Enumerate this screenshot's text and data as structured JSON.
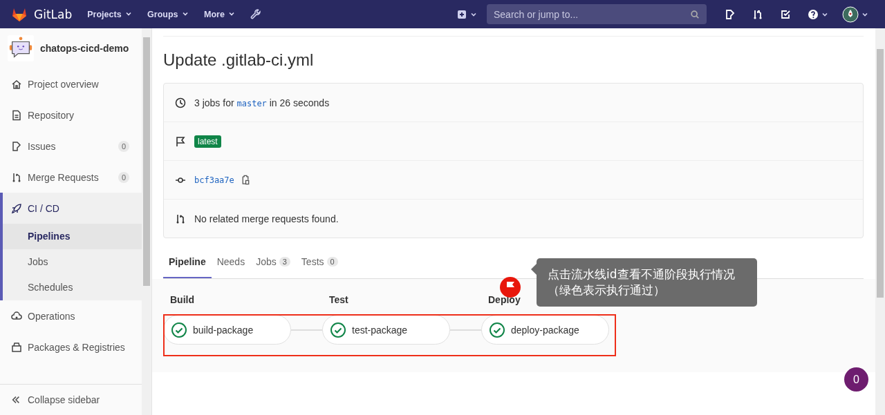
{
  "navbar": {
    "brand": "GitLab",
    "menus": [
      {
        "label": "Projects"
      },
      {
        "label": "Groups"
      },
      {
        "label": "More"
      }
    ],
    "search": {
      "placeholder": "Search or jump to..."
    }
  },
  "sidebar": {
    "project": "chatops-cicd-demo",
    "items": [
      {
        "label": "Project overview",
        "kind": "home",
        "selected": false
      },
      {
        "label": "Repository",
        "kind": "doc",
        "selected": false
      },
      {
        "label": "Issues",
        "kind": "issues",
        "count": "0",
        "selected": false
      },
      {
        "label": "Merge Requests",
        "kind": "merge",
        "count": "0",
        "selected": false
      },
      {
        "label": "CI / CD",
        "kind": "rocket",
        "selected": true,
        "children": [
          {
            "label": "Pipelines",
            "selected": true
          },
          {
            "label": "Jobs",
            "selected": false
          },
          {
            "label": "Schedules",
            "selected": false
          }
        ]
      },
      {
        "label": "Operations",
        "kind": "cloud",
        "selected": false
      },
      {
        "label": "Packages & Registries",
        "kind": "package",
        "selected": false
      }
    ],
    "collapse": "Collapse sidebar"
  },
  "title": "Update .gitlab-ci.yml",
  "info": {
    "jobs_prefix": "3 jobs for",
    "branch": "master",
    "jobs_suffix": "in 26 seconds",
    "badge": "latest",
    "commit": "bcf3aa7e",
    "merge_requests": "No related merge requests found."
  },
  "tabs": [
    {
      "label": "Pipeline",
      "selected": true
    },
    {
      "label": "Needs",
      "selected": false
    },
    {
      "label": "Jobs",
      "count": "3",
      "selected": false
    },
    {
      "label": "Tests",
      "count": "0",
      "selected": false
    }
  ],
  "stages": [
    {
      "name": "Build",
      "job": "build-package",
      "passed": true
    },
    {
      "name": "Test",
      "job": "test-package",
      "passed": true
    },
    {
      "name": "Deploy",
      "job": "deploy-package",
      "passed": true
    }
  ],
  "annotation": {
    "lines": [
      "点击流水线id查看不通阶段执行情况",
      "（绿色表示执行通过）"
    ]
  },
  "floating_badge": "0"
}
